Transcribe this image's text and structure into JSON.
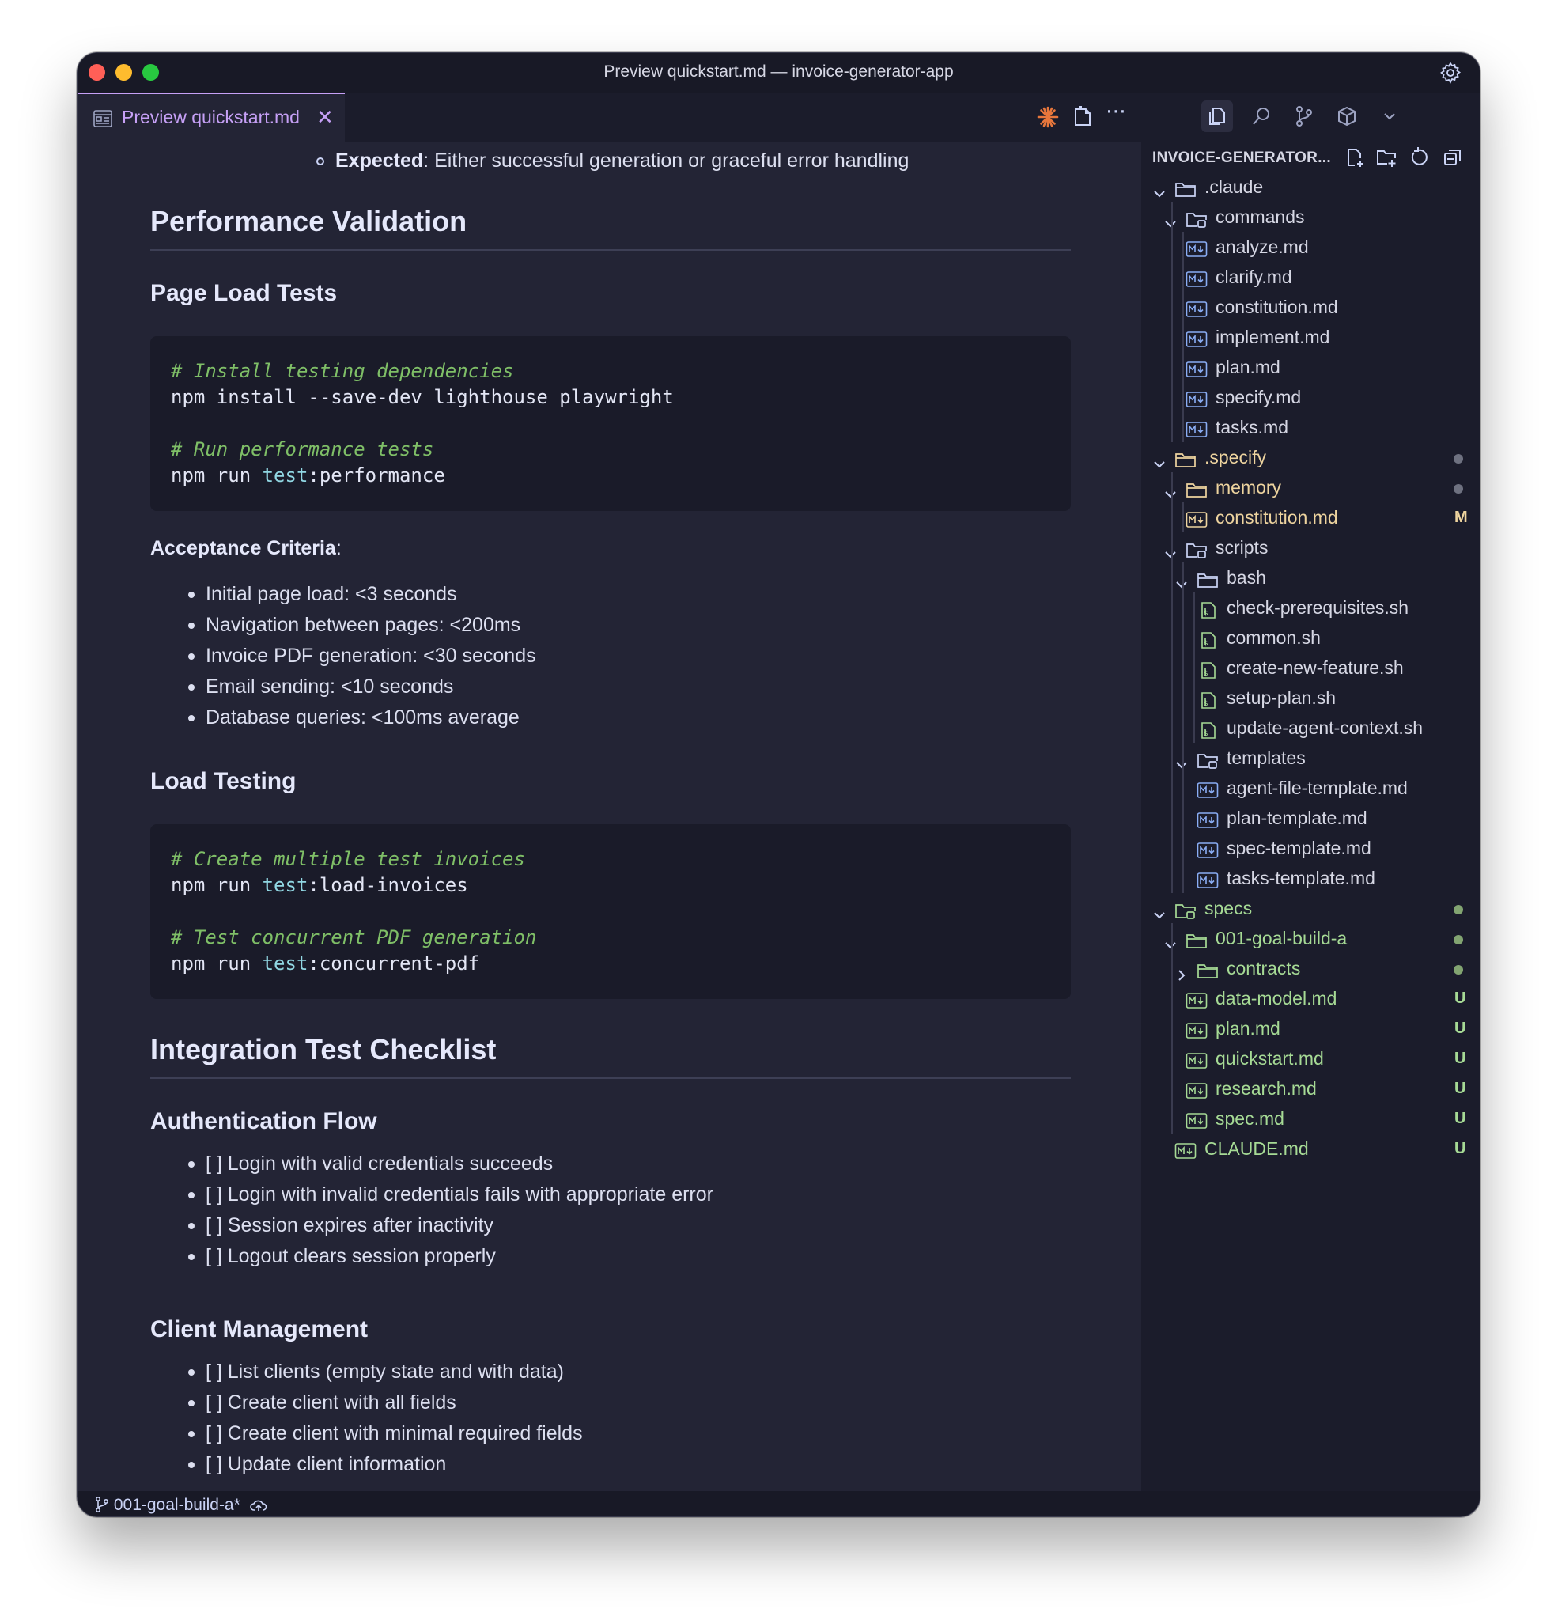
{
  "window": {
    "title": "Preview quickstart.md — invoice-generator-app"
  },
  "tab": {
    "label": "Preview quickstart.md",
    "close": "✕"
  },
  "preview": {
    "expected_label": "Expected",
    "expected_text": ": Either successful generation or graceful error handling",
    "performance_heading": "Performance Validation",
    "page_load_heading": "Page Load Tests",
    "code1": {
      "comment1": "# Install testing dependencies",
      "line1": "npm install --save-dev lighthouse playwright",
      "comment2": "# Run performance tests",
      "line2_pre": "npm run ",
      "line2_kw": "test",
      "line2_post": ":performance"
    },
    "acceptance_label": "Acceptance Criteria",
    "acceptance_colon": ":",
    "acceptance_items": [
      "Initial page load: <3 seconds",
      "Navigation between pages: <200ms",
      "Invoice PDF generation: <30 seconds",
      "Email sending: <10 seconds",
      "Database queries: <100ms average"
    ],
    "load_testing_heading": "Load Testing",
    "code2": {
      "comment1": "# Create multiple test invoices",
      "line1_pre": "npm run ",
      "line1_kw": "test",
      "line1_post": ":load-invoices",
      "comment2": "# Test concurrent PDF generation",
      "line2_pre": "npm run ",
      "line2_kw": "test",
      "line2_post": ":concurrent-pdf"
    },
    "integration_heading": "Integration Test Checklist",
    "auth_heading": "Authentication Flow",
    "auth_items": [
      "[ ] Login with valid credentials succeeds",
      "[ ] Login with invalid credentials fails with appropriate error",
      "[ ] Session expires after inactivity",
      "[ ] Logout clears session properly"
    ],
    "client_heading": "Client Management",
    "client_items": [
      "[ ] List clients (empty state and with data)",
      "[ ] Create client with all fields",
      "[ ] Create client with minimal required fields",
      "[ ] Update client information"
    ]
  },
  "explorer": {
    "title": "INVOICE-GENERATOR...",
    "tree": [
      {
        "label": ".claude",
        "type": "folder",
        "state": "open",
        "color": "default"
      },
      {
        "label": "commands",
        "type": "folder-special",
        "state": "open",
        "color": "default"
      },
      {
        "label": "analyze.md",
        "type": "md",
        "color": "default"
      },
      {
        "label": "clarify.md",
        "type": "md",
        "color": "default"
      },
      {
        "label": "constitution.md",
        "type": "md",
        "color": "default"
      },
      {
        "label": "implement.md",
        "type": "md",
        "color": "default"
      },
      {
        "label": "plan.md",
        "type": "md",
        "color": "default"
      },
      {
        "label": "specify.md",
        "type": "md",
        "color": "default"
      },
      {
        "label": "tasks.md",
        "type": "md",
        "color": "default"
      },
      {
        "label": ".specify",
        "type": "folder",
        "state": "open",
        "color": "yellow",
        "dot": "gray"
      },
      {
        "label": "memory",
        "type": "folder",
        "state": "open",
        "color": "yellow",
        "dot": "gray"
      },
      {
        "label": "constitution.md",
        "type": "md",
        "color": "yellow",
        "badge": "M"
      },
      {
        "label": "scripts",
        "type": "folder-special",
        "state": "open",
        "color": "default"
      },
      {
        "label": "bash",
        "type": "folder",
        "state": "open",
        "color": "default"
      },
      {
        "label": "check-prerequisites.sh",
        "type": "sh",
        "color": "default"
      },
      {
        "label": "common.sh",
        "type": "sh",
        "color": "default"
      },
      {
        "label": "create-new-feature.sh",
        "type": "sh",
        "color": "default"
      },
      {
        "label": "setup-plan.sh",
        "type": "sh",
        "color": "default"
      },
      {
        "label": "update-agent-context.sh",
        "type": "sh",
        "color": "default"
      },
      {
        "label": "templates",
        "type": "folder-special",
        "state": "open",
        "color": "default"
      },
      {
        "label": "agent-file-template.md",
        "type": "md",
        "color": "default"
      },
      {
        "label": "plan-template.md",
        "type": "md",
        "color": "default"
      },
      {
        "label": "spec-template.md",
        "type": "md",
        "color": "default"
      },
      {
        "label": "tasks-template.md",
        "type": "md",
        "color": "default"
      },
      {
        "label": "specs",
        "type": "folder-special",
        "state": "open",
        "color": "green",
        "dot": "green"
      },
      {
        "label": "001-goal-build-a",
        "type": "folder",
        "state": "open",
        "color": "green",
        "dot": "green"
      },
      {
        "label": "contracts",
        "type": "folder",
        "state": "closed",
        "color": "green",
        "dot": "green"
      },
      {
        "label": "data-model.md",
        "type": "md",
        "color": "green",
        "badge": "U"
      },
      {
        "label": "plan.md",
        "type": "md",
        "color": "green",
        "badge": "U"
      },
      {
        "label": "quickstart.md",
        "type": "md",
        "color": "green",
        "badge": "U"
      },
      {
        "label": "research.md",
        "type": "md",
        "color": "green",
        "badge": "U"
      },
      {
        "label": "spec.md",
        "type": "md",
        "color": "green",
        "badge": "U"
      },
      {
        "label": "CLAUDE.md",
        "type": "md",
        "color": "green",
        "badge": "U"
      }
    ]
  },
  "status": {
    "branch": "001-goal-build-a*"
  },
  "colors": {
    "accent": "#c6a0f6",
    "green": "#a6da95",
    "yellow": "#eed49f",
    "comment": "#7fbf67",
    "keyword": "#91d7e3"
  }
}
